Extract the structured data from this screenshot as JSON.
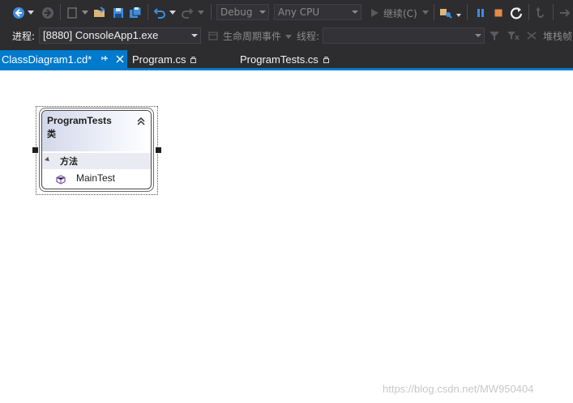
{
  "toolbar": {
    "config_combo": "Debug",
    "platform_combo": "Any CPU",
    "continue_label": "继续(C)",
    "process_label": "进程:",
    "process_value": "[8880] ConsoleApp1.exe",
    "lifecycle_label": "生命周期事件",
    "thread_label": "线程:",
    "thread_value": "",
    "stackframe_label": "堆栈帧"
  },
  "tabs": [
    {
      "label": "ClassDiagram1.cd*",
      "pin": "⊕",
      "close": "×",
      "active": true
    },
    {
      "label": "Program.cs",
      "pin": "ㅁ",
      "active": false
    },
    {
      "label": "ProgramTests.cs",
      "pin": "ㅁ",
      "active": false
    }
  ],
  "diagram": {
    "class_name": "ProgramTests",
    "class_kind": "类",
    "section_label": "方法",
    "methods": [
      "MainTest"
    ]
  },
  "watermark": "https://blog.csdn.net/MW950404",
  "colors": {
    "accent": "#007acc",
    "toolbar_bg": "#2d2d30",
    "pause": "#3e8ede",
    "stop": "#e58a47"
  }
}
